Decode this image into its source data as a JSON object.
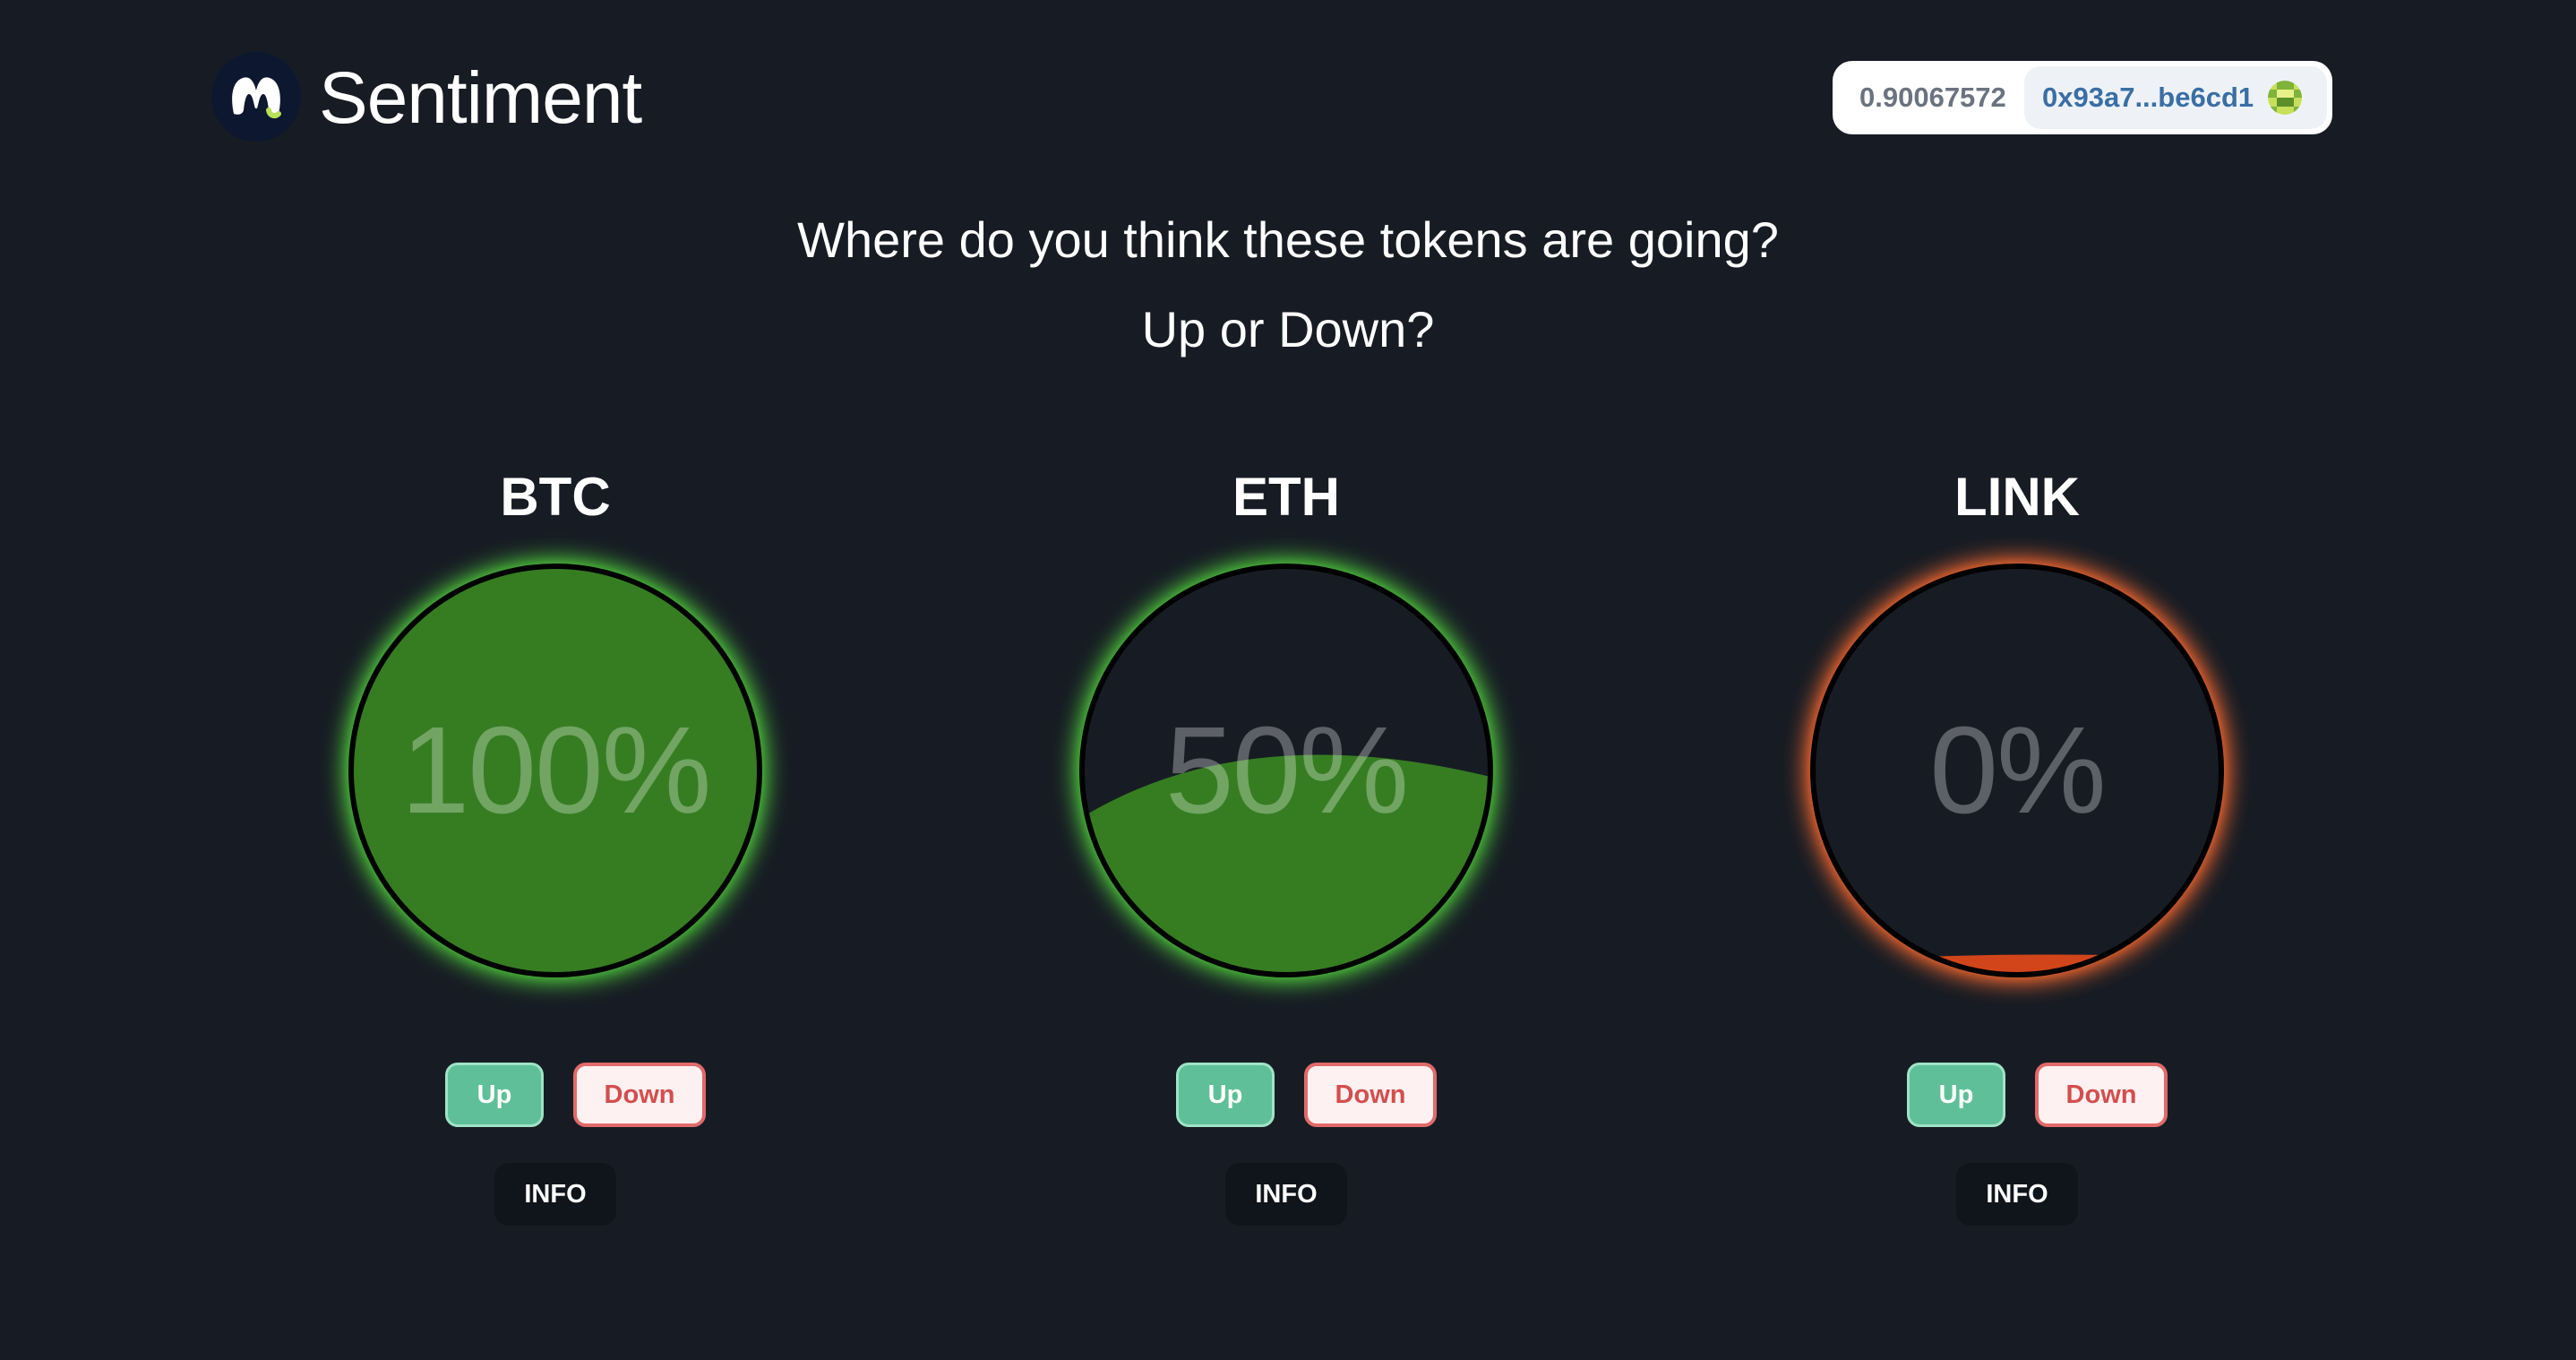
{
  "header": {
    "brand": "Sentiment",
    "balance": "0.90067572",
    "address": "0x93a7...be6cd1"
  },
  "prompt": {
    "headline": "Where do you think these tokens are going?",
    "subline": "Up or Down?"
  },
  "colors": {
    "up_fill": "#367d22",
    "up_glow": "#4cc23a",
    "down_fill": "#d2451a",
    "down_glow": "#f0662e",
    "circle_bg": "#171c24"
  },
  "tokens": [
    {
      "symbol": "BTC",
      "percent_label": "100%",
      "up_fraction": 1.0,
      "sentiment": "up",
      "up_label": "Up",
      "down_label": "Down",
      "info_label": "INFO"
    },
    {
      "symbol": "ETH",
      "percent_label": "50%",
      "up_fraction": 0.5,
      "sentiment": "up",
      "up_label": "Up",
      "down_label": "Down",
      "info_label": "INFO"
    },
    {
      "symbol": "LINK",
      "percent_label": "0%",
      "up_fraction": 0.0,
      "sentiment": "down",
      "up_label": "Up",
      "down_label": "Down",
      "info_label": "INFO"
    }
  ]
}
